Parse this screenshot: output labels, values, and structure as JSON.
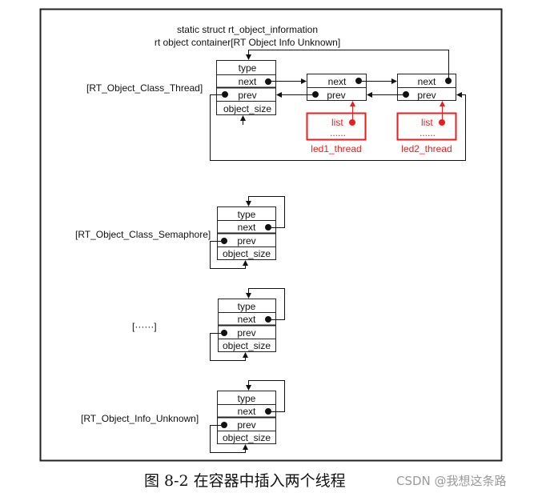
{
  "header": {
    "line1": "static struct rt_object_information",
    "line2": "rt object container[RT Object Info Unknown]"
  },
  "containers": [
    {
      "label": "[RT_Object_Class_Thread]",
      "fields": [
        "type",
        "next",
        "prev",
        "object_size"
      ]
    },
    {
      "label": "[RT_Object_Class_Semaphore]",
      "fields": [
        "type",
        "next",
        "prev",
        "object_size"
      ]
    },
    {
      "label": "[······]",
      "fields": [
        "type",
        "next",
        "prev",
        "object_size"
      ]
    },
    {
      "label": "[RT_Object_Info_Unknown]",
      "fields": [
        "type",
        "next",
        "prev",
        "object_size"
      ]
    }
  ],
  "list_nodes": [
    {
      "next": "next",
      "prev": "prev"
    },
    {
      "next": "next",
      "prev": "prev"
    }
  ],
  "threads": [
    {
      "name": "led1_thread",
      "field": "list",
      "more": "......"
    },
    {
      "name": "led2_thread",
      "field": "list",
      "more": "......"
    }
  ],
  "colors": {
    "line": "#111111",
    "thread": "#ee1c1c"
  },
  "caption": "图 8-2 在容器中插入两个线程",
  "watermark": "CSDN @我想这条路"
}
